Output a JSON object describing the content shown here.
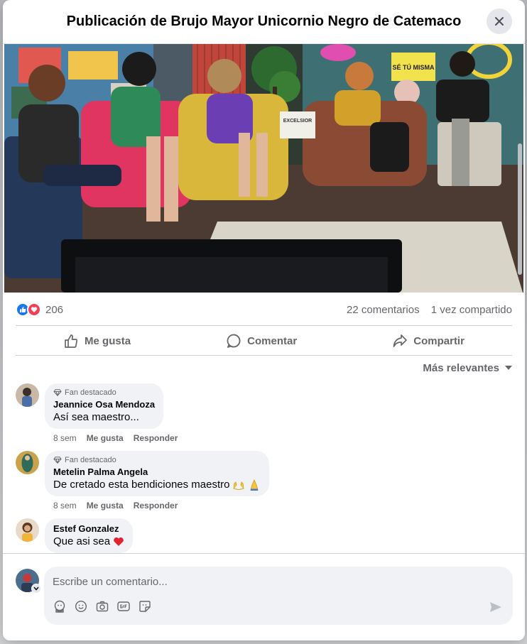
{
  "dialog": {
    "title": "Publicación de Brujo Mayor Unicornio Negro de Catemaco",
    "close_icon": "close-icon"
  },
  "post": {
    "photo_signs": {
      "se_tu_misma": "SÉ TÚ MISMA",
      "excelsior": "EXCELSIOR"
    },
    "reaction_count": "206",
    "comments_count": "22 comentarios",
    "shares_count": "1 vez compartido",
    "reaction_icons": [
      "like-reaction-icon",
      "love-reaction-icon"
    ]
  },
  "actions": {
    "like": "Me gusta",
    "comment": "Comentar",
    "share": "Compartir"
  },
  "sort": {
    "label": "Más relevantes"
  },
  "comments": [
    {
      "badge": "Fan destacado",
      "author": "Jeannice Osa Mendoza",
      "text": "Así sea maestro...",
      "time": "8 sem",
      "like": "Me gusta",
      "reply": "Responder"
    },
    {
      "badge": "Fan destacado",
      "author": "Metelin Palma Angela",
      "text": "De cretado esta bendiciones maestro",
      "time": "8 sem",
      "like": "Me gusta",
      "reply": "Responder"
    },
    {
      "badge": "",
      "author": "Estef Gonzalez",
      "text": "Que asi sea"
    }
  ],
  "composer": {
    "placeholder": "Escribe un comentario...",
    "tools": [
      "avatar-sticker-icon",
      "emoji-icon",
      "camera-icon",
      "gif-icon",
      "sticker-icon"
    ],
    "send_icon": "send-icon"
  },
  "colors": {
    "facebook_blue": "#1877f2",
    "love_red": "#f33e58",
    "bubble_bg": "#f0f2f5",
    "secondary_text": "#65676b"
  }
}
